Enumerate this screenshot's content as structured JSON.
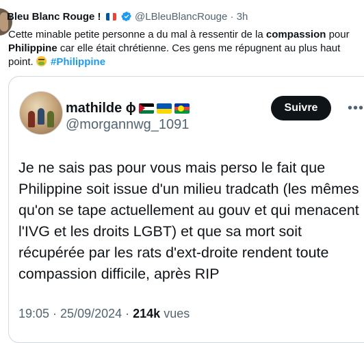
{
  "tweet": {
    "author_name": "Bleu Blanc Rouge !",
    "author_handle": "@LBleuBlancRouge",
    "separator": "·",
    "time": "3h",
    "text_1": "Cette minable petite personne a du mal à ressentir de la ",
    "bold_1": "compassion",
    "text_2": " pour ",
    "bold_2": "Philippine",
    "text_3": " car elle était chrétienne. Ces gens me répugnent au plus haut point. ",
    "hashtag": "#Philippine"
  },
  "quote": {
    "author_name": "mathilde ɸ",
    "author_handle": "@morgannwg_1091",
    "follow_label": "Suivre",
    "body": "Je ne sais pas pour vous mais perso le fait que Philippine soit issue d'un milieu tradcath (les mêmes qu'on se tape actuellement au gouv et qui menacent l'IVG et les droits LGBT) et que sa mort soit récupérée par les rats d'ext-droite rendent toute compassion difficile, après RIP",
    "timestamp": "19:05 · 25/09/2024 · ",
    "views_count": "214k",
    "views_label": "vues"
  },
  "colors": {
    "link": "#1d9bf0",
    "secondary_text": "#536471",
    "button_bg": "#0f1419",
    "border": "#cfd9de"
  },
  "icons": [
    "flag-france-icon",
    "verified-badge-icon",
    "sick-face-emoji-icon",
    "flag-palestine-icon",
    "flag-ukraine-icon",
    "flag-new-caledonia-icon",
    "more-options-icon"
  ]
}
